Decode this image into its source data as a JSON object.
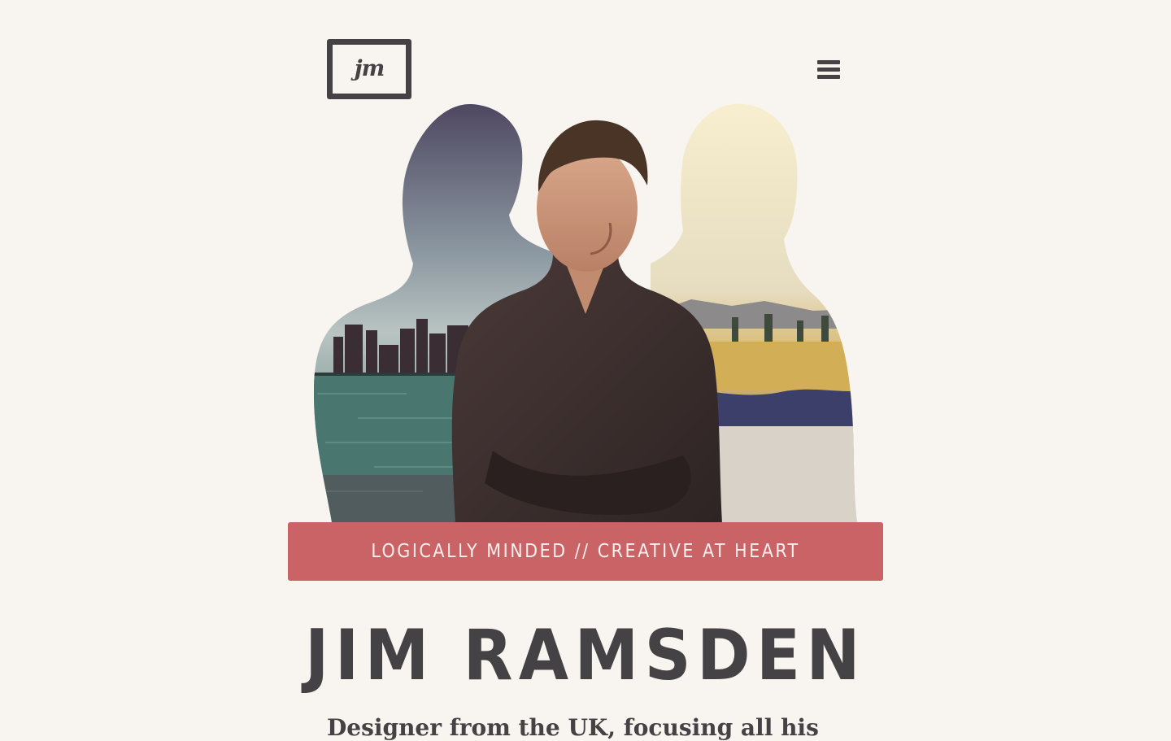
{
  "header": {
    "logo_text": "jm",
    "menu_icon": "hamburger-menu-icon"
  },
  "hero": {
    "image_description_icon": "portrait-collage",
    "tagline": "LOGICALLY MINDED // CREATIVE AT HEART"
  },
  "main": {
    "name": "JIM RAMSDEN",
    "intro": "Designer from the UK, focusing all his"
  },
  "colors": {
    "background": "#f8f4ef",
    "text": "#444244",
    "accent": "#c96365"
  }
}
